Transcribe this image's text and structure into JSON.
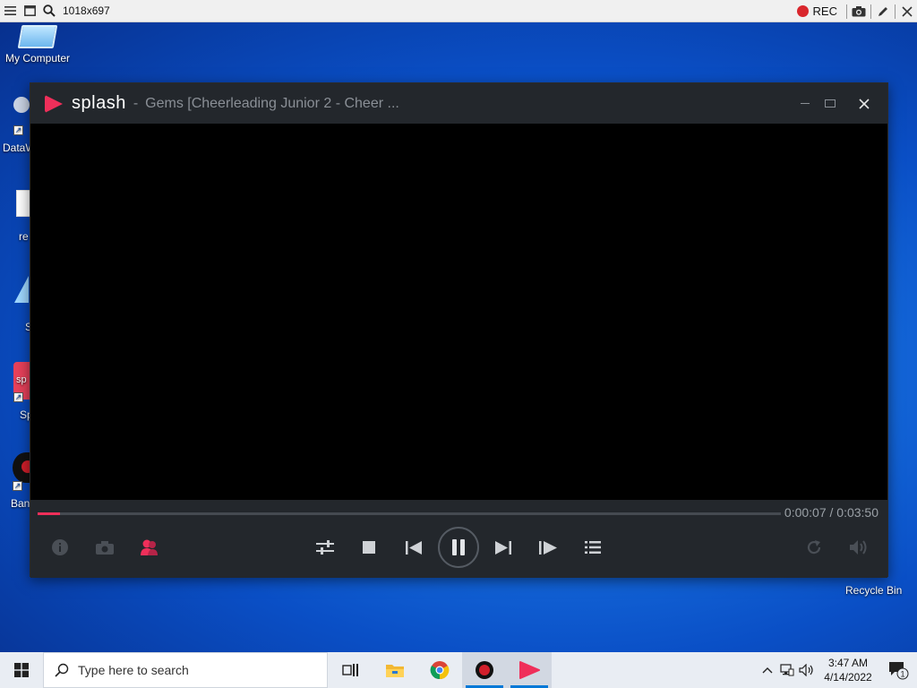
{
  "topbar": {
    "resolution": "1018x697",
    "rec_label": "REC"
  },
  "desktop": {
    "icons": [
      {
        "label": "My Computer"
      },
      {
        "label": "DataW"
      },
      {
        "label": "re"
      },
      {
        "label": "S"
      },
      {
        "label": "Sp"
      },
      {
        "label": "Ban"
      }
    ],
    "recycle_bin": "Recycle Bin"
  },
  "player": {
    "brand": "splash",
    "title_separator": "-",
    "title": "Gems  [Cheerleading Junior 2 - Cheer ...",
    "timecode": "0:00:07 / 0:03:50",
    "progress_fraction": 0.03,
    "accent": "#ef2f5a"
  },
  "taskbar": {
    "search_placeholder": "Type here to search",
    "time": "3:47 AM",
    "date": "4/14/2022",
    "notification_count": "1"
  }
}
